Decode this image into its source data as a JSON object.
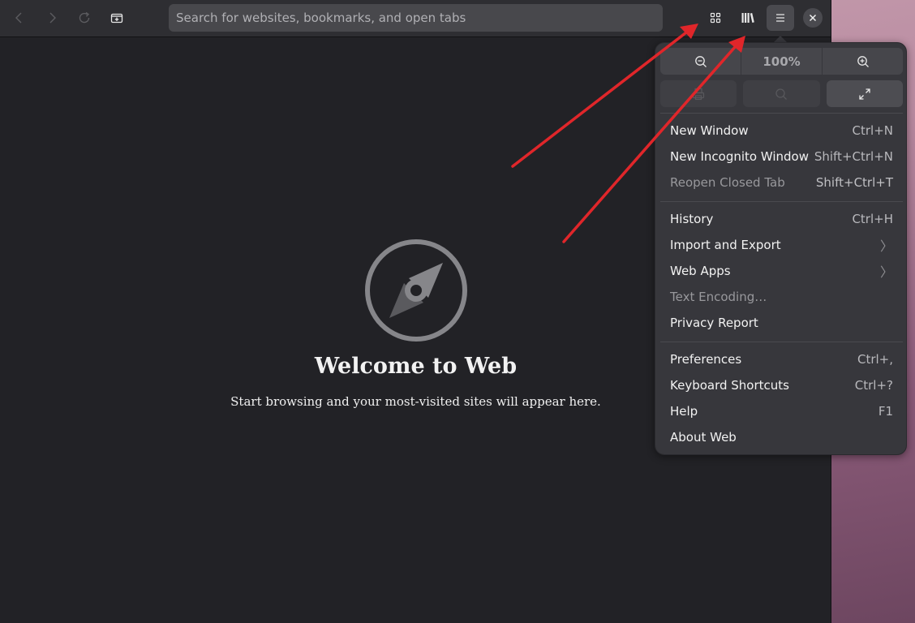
{
  "app": {
    "name": "Web",
    "colors": {
      "accent": "#e0262a",
      "background": "#222226",
      "headerbar": "#2e2e32",
      "popover": "#37373c"
    }
  },
  "toolbar": {
    "back_icon": "chevron-left-icon",
    "forward_icon": "chevron-right-icon",
    "reload_icon": "reload-icon",
    "new_tab_icon": "new-tab-icon",
    "search_placeholder": "Search for websites, bookmarks, and open tabs",
    "tab_overview_icon": "grid-icon",
    "library_icon": "library-icon",
    "menu_icon": "hamburger-menu-icon",
    "close_icon": "close-icon"
  },
  "welcome": {
    "title": "Welcome to Web",
    "subtitle": "Start browsing and your most-visited sites will appear here.",
    "icon": "compass-icon"
  },
  "menu": {
    "zoom": {
      "out_icon": "zoom-out-icon",
      "level": "100%",
      "in_icon": "zoom-in-icon"
    },
    "actions": [
      {
        "icon": "print-icon",
        "enabled": false
      },
      {
        "icon": "find-icon",
        "enabled": false
      },
      {
        "icon": "fullscreen-icon",
        "enabled": true
      }
    ],
    "groups": [
      [
        {
          "label": "New Window",
          "accel": "Ctrl+N",
          "enabled": true
        },
        {
          "label": "New Incognito Window",
          "accel": "Shift+Ctrl+N",
          "enabled": true
        },
        {
          "label": "Reopen Closed Tab",
          "accel": "Shift+Ctrl+T",
          "enabled": false
        }
      ],
      [
        {
          "label": "History",
          "accel": "Ctrl+H",
          "enabled": true
        },
        {
          "label": "Import and Export",
          "accel": "〉",
          "enabled": true
        },
        {
          "label": "Web Apps",
          "accel": "〉",
          "enabled": true
        },
        {
          "label": "Text Encoding…",
          "accel": "",
          "enabled": false
        },
        {
          "label": "Privacy Report",
          "accel": "",
          "enabled": true
        }
      ],
      [
        {
          "label": "Preferences",
          "accel": "Ctrl+,",
          "enabled": true
        },
        {
          "label": "Keyboard Shortcuts",
          "accel": "Ctrl+?",
          "enabled": true
        },
        {
          "label": "Help",
          "accel": "F1",
          "enabled": true
        },
        {
          "label": "About Web",
          "accel": "",
          "enabled": true
        }
      ]
    ]
  }
}
